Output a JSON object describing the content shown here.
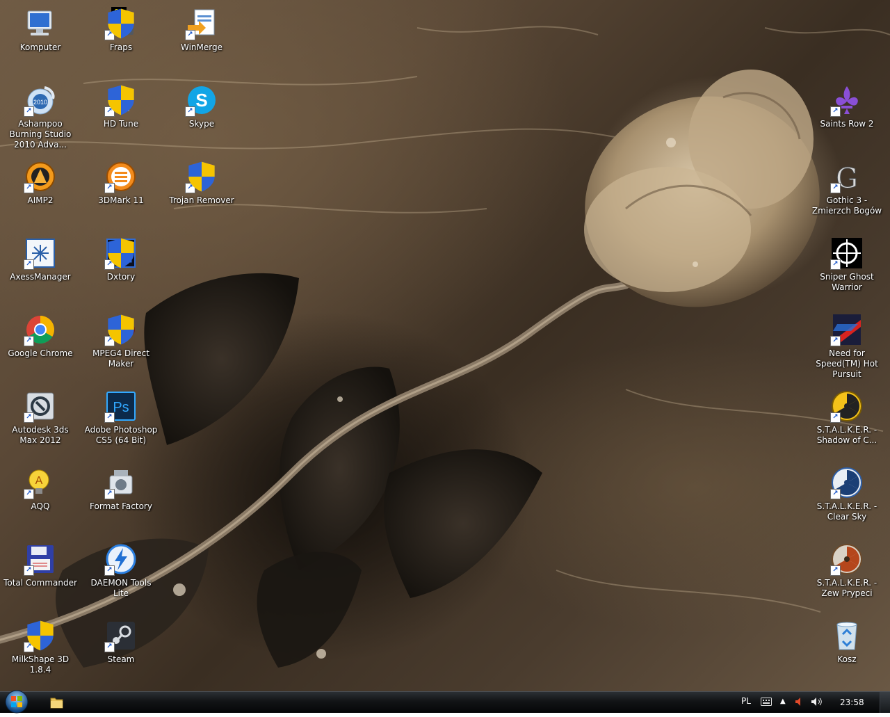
{
  "desktop": {
    "icons": [
      {
        "label": "Komputer",
        "icon": "computer-icon",
        "shortcut": false,
        "shield": false
      },
      {
        "label": "Fraps",
        "icon": "fraps-icon",
        "shortcut": true,
        "shield": true
      },
      {
        "label": "WinMerge",
        "icon": "winmerge-icon",
        "shortcut": true,
        "shield": false
      },
      {
        "label": "Ashampoo Burning Studio 2010 Adva...",
        "icon": "ashampoo-icon",
        "shortcut": true,
        "shield": false
      },
      {
        "label": "HD Tune",
        "icon": "hdtune-icon",
        "shortcut": true,
        "shield": true
      },
      {
        "label": "Skype",
        "icon": "skype-icon",
        "shortcut": true,
        "shield": false
      },
      {
        "label": "AIMP2",
        "icon": "aimp-icon",
        "shortcut": true,
        "shield": false
      },
      {
        "label": "3DMark 11",
        "icon": "3dmark-icon",
        "shortcut": true,
        "shield": false
      },
      {
        "label": "Trojan Remover",
        "icon": "trojan-remover-icon",
        "shortcut": true,
        "shield": true
      },
      {
        "label": "AxessManager",
        "icon": "axess-icon",
        "shortcut": true,
        "shield": false
      },
      {
        "label": "Dxtory",
        "icon": "dxtory-icon",
        "shortcut": true,
        "shield": true
      },
      {
        "label": "Google Chrome",
        "icon": "chrome-icon",
        "shortcut": true,
        "shield": false
      },
      {
        "label": "MPEG4 Direct Maker",
        "icon": "mpeg4-icon",
        "shortcut": true,
        "shield": true
      },
      {
        "label": "Autodesk 3ds Max 2012",
        "icon": "3dsmax-icon",
        "shortcut": true,
        "shield": false
      },
      {
        "label": "Adobe Photoshop CS5 (64 Bit)",
        "icon": "photoshop-icon",
        "shortcut": true,
        "shield": false
      },
      {
        "label": "AQQ",
        "icon": "aqq-icon",
        "shortcut": true,
        "shield": false
      },
      {
        "label": "Format Factory",
        "icon": "format-factory-icon",
        "shortcut": true,
        "shield": false
      },
      {
        "label": "Total Commander",
        "icon": "total-commander-icon",
        "shortcut": true,
        "shield": false
      },
      {
        "label": "DAEMON Tools Lite",
        "icon": "daemon-tools-icon",
        "shortcut": true,
        "shield": false
      },
      {
        "label": "MilkShape 3D 1.8.4",
        "icon": "milkshape-icon",
        "shortcut": true,
        "shield": true
      },
      {
        "label": "Steam",
        "icon": "steam-icon",
        "shortcut": true,
        "shield": false
      },
      {
        "label": "Saints Row 2",
        "icon": "saints-row-icon",
        "shortcut": true,
        "shield": false
      },
      {
        "label": "Gothic 3 - Zmierzch Bogów",
        "icon": "gothic-icon",
        "shortcut": true,
        "shield": false
      },
      {
        "label": "Sniper Ghost Warrior",
        "icon": "sniper-icon",
        "shortcut": true,
        "shield": false
      },
      {
        "label": "Need for Speed(TM) Hot Pursuit",
        "icon": "nfs-icon",
        "shortcut": true,
        "shield": false
      },
      {
        "label": "S.T.A.L.K.E.R. - Shadow of C...",
        "icon": "stalker-soc-icon",
        "shortcut": true,
        "shield": false
      },
      {
        "label": "S.T.A.L.K.E.R. - Clear Sky",
        "icon": "stalker-cs-icon",
        "shortcut": true,
        "shield": false
      },
      {
        "label": "S.T.A.L.K.E.R. - Zew Prypeci",
        "icon": "stalker-cop-icon",
        "shortcut": true,
        "shield": false
      },
      {
        "label": "Kosz",
        "icon": "recycle-bin-icon",
        "shortcut": false,
        "shield": false
      }
    ]
  },
  "taskbar": {
    "start_icon": "windows-orb-icon",
    "pinned": [
      {
        "icon": "folder-icon"
      }
    ],
    "tray": {
      "language": "PL",
      "clock": "23:58"
    }
  },
  "colors": {
    "taskbar": "#0e1012",
    "label_text": "#ffffff"
  }
}
